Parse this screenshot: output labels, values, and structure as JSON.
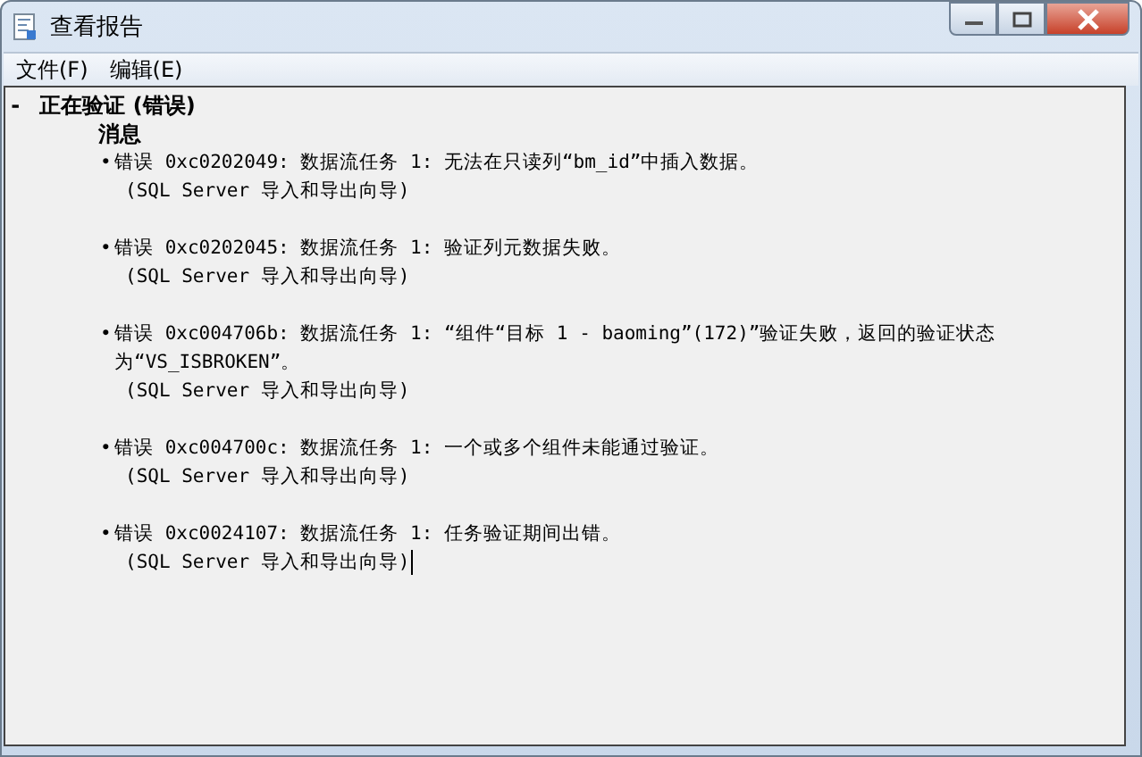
{
  "window": {
    "title": "查看报告"
  },
  "menu": [
    "文件(F)",
    "编辑(E)"
  ],
  "report": {
    "toggle": "-",
    "heading": "正在验证 (错误)",
    "section": "消息",
    "messages": [
      {
        "bullet": "•",
        "text": "错误 0xc0202049: 数据流任务 1: 无法在只读列“bm_id”中插入数据。",
        "source": "(SQL Server 导入和导出向导)"
      },
      {
        "bullet": "•",
        "text": "错误 0xc0202045: 数据流任务 1: 验证列元数据失败。",
        "source": "(SQL Server 导入和导出向导)"
      },
      {
        "bullet": "•",
        "text": "错误 0xc004706b: 数据流任务 1: “组件“目标 1 - baoming”(172)”验证失败，返回的验证状态为“VS_ISBROKEN”。",
        "source": "(SQL Server 导入和导出向导)"
      },
      {
        "bullet": "•",
        "text": "错误 0xc004700c: 数据流任务 1: 一个或多个组件未能通过验证。",
        "source": "(SQL Server 导入和导出向导)"
      },
      {
        "bullet": "•",
        "text": "错误 0xc0024107: 数据流任务 1: 任务验证期间出错。",
        "source": "(SQL Server 导入和导出向导)"
      }
    ]
  }
}
